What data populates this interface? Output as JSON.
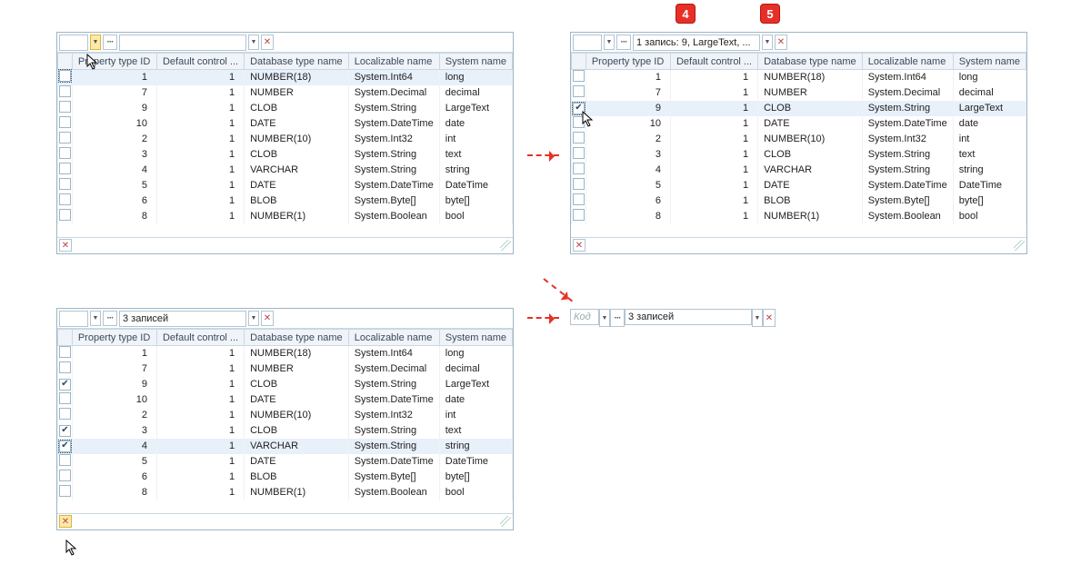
{
  "callouts": {
    "c4": "4",
    "c5": "5"
  },
  "columns": {
    "chk": "",
    "propTypeId": "Property type ID",
    "defaultControl": "Default control ...",
    "dbTypeName": "Database type name",
    "locName": "Localizable name",
    "sysName": "System name"
  },
  "rows": [
    {
      "propTypeId": 1,
      "defaultControl": 1,
      "dbTypeName": "NUMBER(18)",
      "locName": "System.Int64",
      "sysName": "long"
    },
    {
      "propTypeId": 7,
      "defaultControl": 1,
      "dbTypeName": "NUMBER",
      "locName": "System.Decimal",
      "sysName": "decimal"
    },
    {
      "propTypeId": 9,
      "defaultControl": 1,
      "dbTypeName": "CLOB",
      "locName": "System.String",
      "sysName": "LargeText"
    },
    {
      "propTypeId": 10,
      "defaultControl": 1,
      "dbTypeName": "DATE",
      "locName": "System.DateTime",
      "sysName": "date"
    },
    {
      "propTypeId": 2,
      "defaultControl": 1,
      "dbTypeName": "NUMBER(10)",
      "locName": "System.Int32",
      "sysName": "int"
    },
    {
      "propTypeId": 3,
      "defaultControl": 1,
      "dbTypeName": "CLOB",
      "locName": "System.String",
      "sysName": "text"
    },
    {
      "propTypeId": 4,
      "defaultControl": 1,
      "dbTypeName": "VARCHAR",
      "locName": "System.String",
      "sysName": "string"
    },
    {
      "propTypeId": 5,
      "defaultControl": 1,
      "dbTypeName": "DATE",
      "locName": "System.DateTime",
      "sysName": "DateTime"
    },
    {
      "propTypeId": 6,
      "defaultControl": 1,
      "dbTypeName": "BLOB",
      "locName": "System.Byte[]",
      "sysName": "byte[]"
    },
    {
      "propTypeId": 8,
      "defaultControl": 1,
      "dbTypeName": "NUMBER(1)",
      "locName": "System.Boolean",
      "sysName": "bool"
    }
  ],
  "topLeft": {
    "toolbar2_value": "",
    "selectedIndex": 0,
    "checked": [],
    "focusRow": 0,
    "hlDropdown1": true
  },
  "topRight": {
    "toolbar2_value": "1 запись: 9, LargeText, ...",
    "selectedIndex": 2,
    "checked": [
      2
    ],
    "focusRow": 2
  },
  "bottomLeft": {
    "toolbar2_value": "3 записей",
    "selectedIndex": 6,
    "checked": [
      2,
      5,
      6
    ],
    "focusRow": 6,
    "footerClearHl": true
  },
  "mini": {
    "input1_placeholder": "Код",
    "input2_value": "3 записей"
  }
}
